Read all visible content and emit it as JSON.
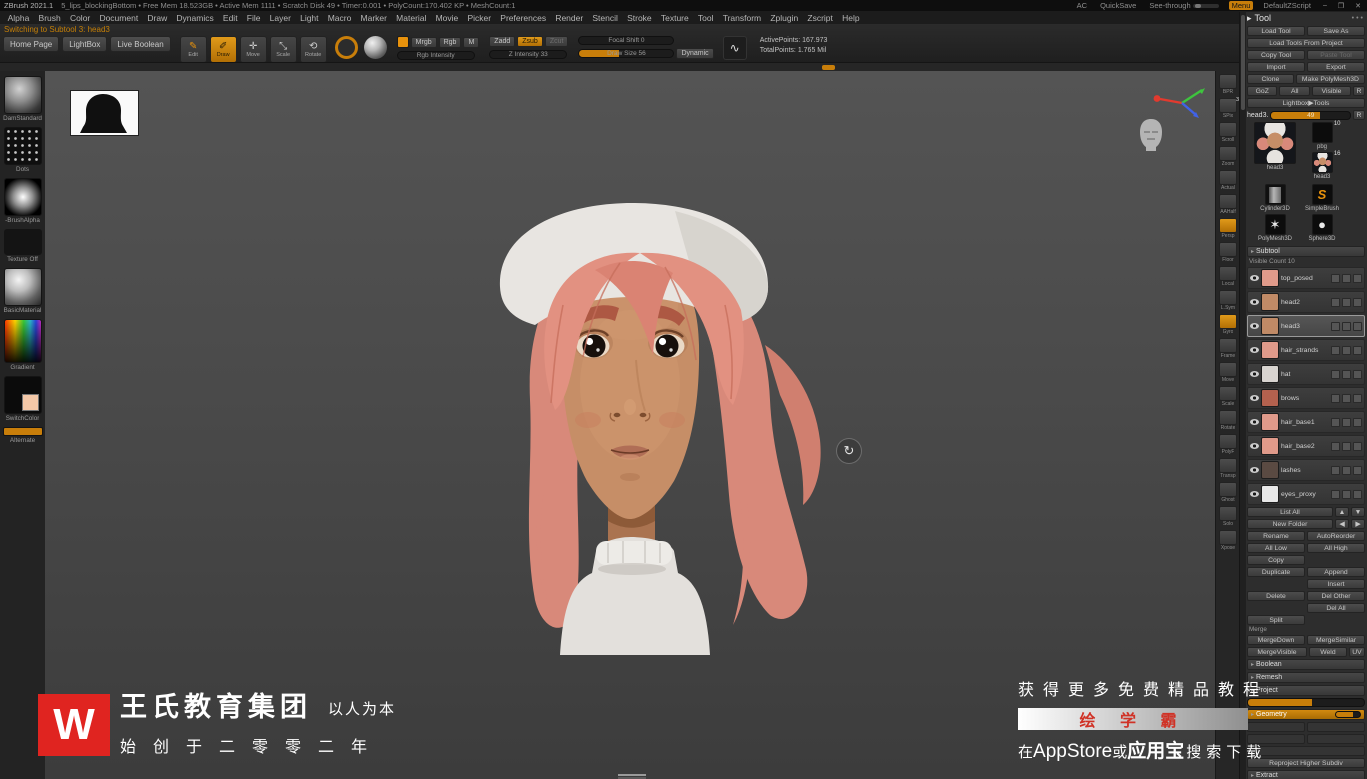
{
  "title_bar": {
    "app_title": "ZBrush 2021.1",
    "doc_info": "5_lips_blockingBottom • Free Mem 18.523GB • Active Mem 1111 • Scratch Disk 49 • Timer:0.001 • PolyCount:170.402 KP • MeshCount:1",
    "min": "–",
    "max": "❐",
    "close": "✕"
  },
  "menu_bar": {
    "items": [
      "Alpha",
      "Brush",
      "Color",
      "Document",
      "Draw",
      "Dynamics",
      "Edit",
      "File",
      "Layer",
      "Light",
      "Macro",
      "Marker",
      "Material",
      "Movie",
      "Picker",
      "Preferences",
      "Render",
      "Stencil",
      "Stroke",
      "Texture",
      "Tool",
      "Transform",
      "Zplugin",
      "Zscript",
      "Help"
    ],
    "right": [
      "AC",
      "QuickSave",
      "See-through",
      "Menu",
      "DefaultZScript"
    ]
  },
  "status_message": "Switching to Subtool 3: head3",
  "toolbar": {
    "home_page": "Home Page",
    "lightbox": "LightBox",
    "live_boolean": "Live Boolean",
    "edit": "Edit",
    "draw": "Draw",
    "move": "Move",
    "scale": "Scale",
    "rotate": "Rotate",
    "mrgb": "Mrgb",
    "rgb": "Rgb",
    "m": "M",
    "zadd": "Zadd",
    "zsub": "Zsub",
    "zcut": "Zcut",
    "rgb_intensity": "Rgb Intensity",
    "z_intensity": "Z Intensity 33",
    "focal_shift": "Focal Shift 0",
    "draw_size": "Draw Size 56",
    "dynamic": "Dynamic",
    "active_points": "ActivePoints: 167.973",
    "total_points": "TotalPoints: 1.765 Mil"
  },
  "icons": {
    "edit": "✎",
    "draw": "✐",
    "move": "✛",
    "scale": "⤡",
    "rotate": "⟲",
    "stroke_glyph": "∿",
    "rotate_hint": "↻",
    "caret": "▸",
    "dots": "•••",
    "up": "▲",
    "down": "▼",
    "left": "◀",
    "right": "▶",
    "star": "✶",
    "sphere": "●",
    "s_brush": "S"
  },
  "left_shelf": {
    "items": [
      {
        "label": "DamStandard",
        "kind": "brush"
      },
      {
        "label": "Dots",
        "kind": "stroke"
      },
      {
        "label": "-BrushAlpha",
        "kind": "alpha"
      },
      {
        "label": "Texture Off",
        "kind": "texture"
      },
      {
        "label": "BasicMaterial",
        "kind": "material"
      },
      {
        "label": "Gradient",
        "kind": "picker"
      },
      {
        "label": "SwitchColor",
        "kind": "switch"
      },
      {
        "label": "Alternate",
        "kind": "alt"
      }
    ]
  },
  "right_shelf": {
    "items": [
      {
        "label": "BPR"
      },
      {
        "label": "SPix",
        "badge": "3"
      },
      {
        "label": "Scroll"
      },
      {
        "label": "Zoom"
      },
      {
        "label": "Actual"
      },
      {
        "label": "AAHalf"
      },
      {
        "label": "Persp",
        "active": true
      },
      {
        "label": "Floor"
      },
      {
        "label": "Local"
      },
      {
        "label": "L.Sym"
      },
      {
        "label": "Gyro",
        "active": true
      },
      {
        "label": "Frame"
      },
      {
        "label": "Move"
      },
      {
        "label": "Scale"
      },
      {
        "label": "Rotate"
      },
      {
        "label": "PolyF"
      },
      {
        "label": "Transp"
      },
      {
        "label": "Ghost"
      },
      {
        "label": "Solo"
      },
      {
        "label": "Xpose"
      }
    ]
  },
  "tool_panel": {
    "title": "Tool",
    "rows": [
      [
        "Load Tool",
        "Save As"
      ],
      [
        "Load Tools From Project"
      ],
      [
        "Copy Tool",
        "Paste Tool"
      ],
      [
        "Import",
        "Export"
      ],
      [
        "Clone",
        "Make PolyMesh3D"
      ],
      [
        "GoZ",
        "All",
        "Visible",
        "R"
      ]
    ],
    "lightbox_tools": "Lightbox▶Tools",
    "current_tool": {
      "name": "head3.",
      "value": "49",
      "r": "R"
    },
    "thumbs": [
      {
        "name": "head3"
      },
      {
        "name": "pbg",
        "badge": "10"
      },
      {
        "name": "head3",
        "badge": "16"
      },
      {
        "name": "Cylinder3D"
      },
      {
        "name": "SimpleBrush"
      },
      {
        "name": "PolyMesh3D"
      },
      {
        "name": "Sphere3D"
      }
    ]
  },
  "subtool": {
    "title": "Subtool",
    "visible_count": "Visible Count 10",
    "items": [
      {
        "name": "top_posed",
        "tint": "#e09a8a"
      },
      {
        "name": "head2",
        "tint": "#c08a66"
      },
      {
        "name": "head3",
        "tint": "#c08a66",
        "active": true
      },
      {
        "name": "hair_strands",
        "tint": "#e09a8a"
      },
      {
        "name": "hat",
        "tint": "#d8d4d0"
      },
      {
        "name": "brows",
        "tint": "#b4614e"
      },
      {
        "name": "hair_base1",
        "tint": "#e09a8a"
      },
      {
        "name": "hair_base2",
        "tint": "#e09a8a"
      },
      {
        "name": "lashes",
        "tint": "#5a4a42"
      },
      {
        "name": "eyes_proxy",
        "tint": "#e8e8e8"
      }
    ],
    "list_all": "List All",
    "new_folder": "New Folder",
    "button_rows": [
      [
        "Rename",
        "AutoReorder"
      ],
      [
        "All Low",
        "All High"
      ],
      [
        "Copy",
        ""
      ],
      [
        "Duplicate",
        "Append"
      ],
      [
        "",
        "Insert"
      ],
      [
        "Delete",
        "Del Other"
      ],
      [
        "",
        "Del All"
      ]
    ],
    "split": "Split",
    "merge_label": "Merge",
    "merge_row1": [
      "MergeDown",
      "MergeSimilar"
    ],
    "merge_row2": [
      "MergeVisible",
      "Weld",
      "UV"
    ],
    "sections": [
      "Boolean",
      "Remesh",
      "Project"
    ],
    "geometry_label": "Geometry",
    "reproject": "Reproject Higher Subdiv",
    "extract": "Extract"
  },
  "watermark": {
    "left": {
      "logo": "W",
      "company": "王氏教育集团",
      "slogan": "以人为本",
      "since": "始创于二零零二年"
    },
    "right": {
      "line1": "获得更多免费精品教程",
      "brand": "绘 学 霸",
      "l2_pre": "在",
      "l2_app": "AppStore",
      "l2_or": "或",
      "l2_yyb": "应用宝",
      "l2_suf": "搜索下载"
    }
  }
}
